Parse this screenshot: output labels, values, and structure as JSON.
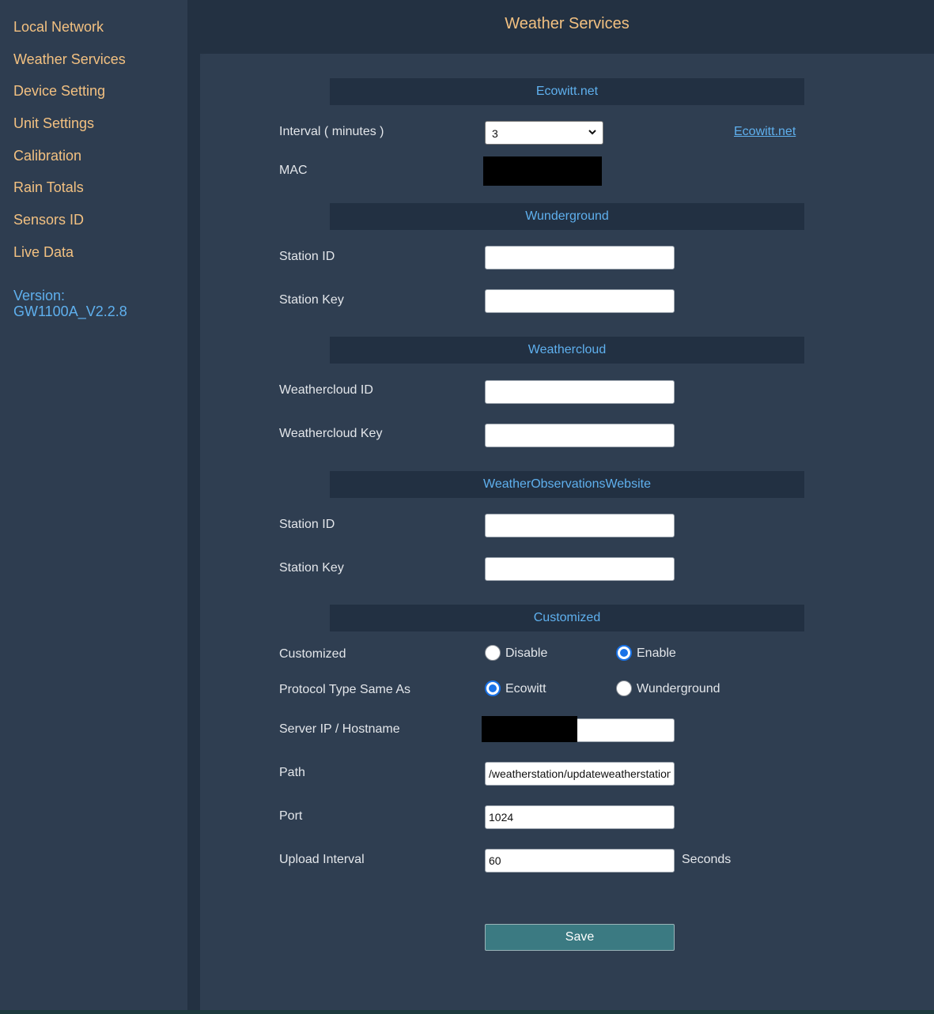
{
  "sidebar": {
    "items": [
      {
        "label": "Local Network"
      },
      {
        "label": "Weather Services"
      },
      {
        "label": "Device Setting"
      },
      {
        "label": "Unit Settings"
      },
      {
        "label": "Calibration"
      },
      {
        "label": "Rain Totals"
      },
      {
        "label": "Sensors ID"
      },
      {
        "label": "Live Data"
      }
    ],
    "version_label": "Version:",
    "version_value": "GW1100A_V2.2.8"
  },
  "page": {
    "title": "Weather Services"
  },
  "ecowitt": {
    "header": "Ecowitt.net",
    "interval_label": "Interval ( minutes )",
    "interval_value": "3",
    "link_text": "Ecowitt.net",
    "mac_label": "MAC"
  },
  "wunderground": {
    "header": "Wunderground",
    "station_id_label": "Station ID",
    "station_id_value": "",
    "station_key_label": "Station Key",
    "station_key_value": ""
  },
  "weathercloud": {
    "header": "Weathercloud",
    "id_label": "Weathercloud ID",
    "id_value": "",
    "key_label": "Weathercloud Key",
    "key_value": ""
  },
  "wow": {
    "header": "WeatherObservationsWebsite",
    "station_id_label": "Station ID",
    "station_id_value": "",
    "station_key_label": "Station Key",
    "station_key_value": ""
  },
  "customized": {
    "header": "Customized",
    "customized_label": "Customized",
    "disable_label": "Disable",
    "enable_label": "Enable",
    "protocol_label": "Protocol Type Same As",
    "ecowitt_label": "Ecowitt",
    "wunderground_label": "Wunderground",
    "server_label": "Server IP / Hostname",
    "server_value": "",
    "path_label": "Path",
    "path_value": "/weatherstation/updateweatherstation.php",
    "port_label": "Port",
    "port_value": "1024",
    "upload_label": "Upload Interval",
    "upload_value": "60",
    "upload_unit": "Seconds"
  },
  "actions": {
    "save_label": "Save"
  },
  "colors": {
    "accent_orange": "#f3c181",
    "accent_blue": "#5fb0ee",
    "background": "#2e3d50",
    "header_bar": "#223042",
    "save_button": "#3b7a82"
  }
}
